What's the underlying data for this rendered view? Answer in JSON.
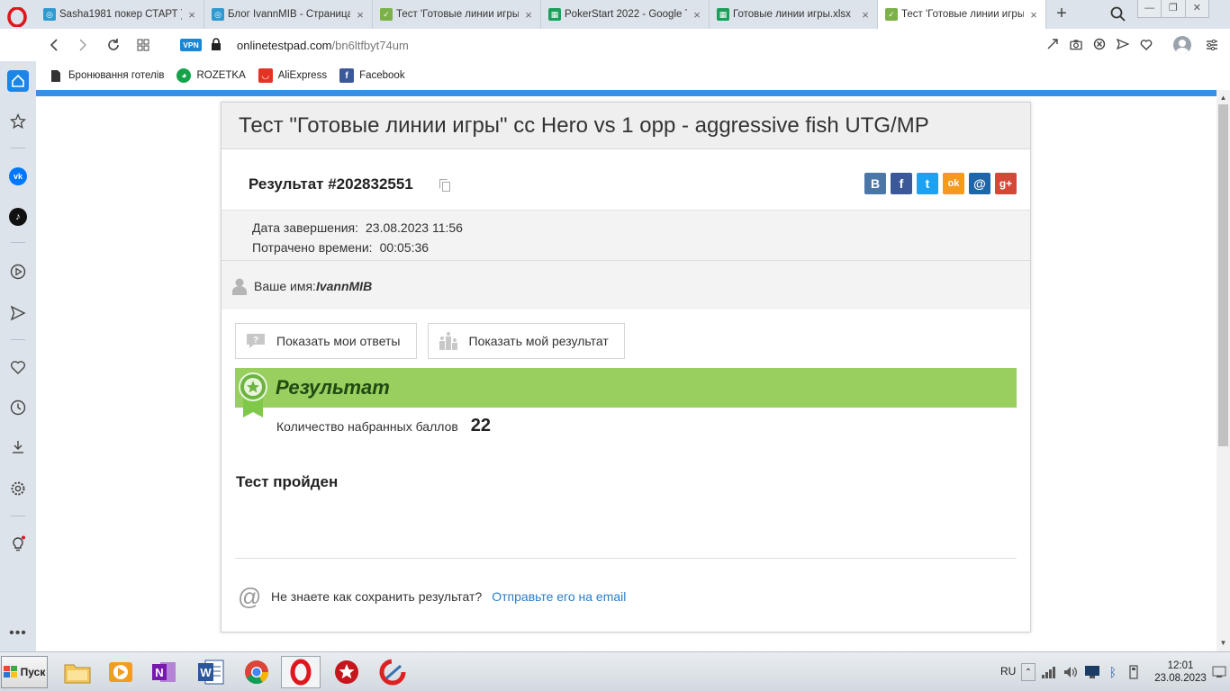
{
  "browser": {
    "tabs": [
      {
        "title": "Sasha1981 покер СТАРТ )",
        "favicon": "poker-globe-icon",
        "color": "#2e9ad0",
        "active": false
      },
      {
        "title": "Блог IvannMIB - Страница",
        "favicon": "poker-globe-icon",
        "color": "#2e9ad0",
        "active": false
      },
      {
        "title": "Тест 'Готовые линии игры",
        "favicon": "onlinetestpad-icon",
        "color": "#7bb04a",
        "active": false
      },
      {
        "title": "PokerStart 2022 - Google T",
        "favicon": "google-sheets-icon",
        "color": "#1e9e5a",
        "active": false
      },
      {
        "title": "Готовые линии игры.xlsx",
        "favicon": "google-sheets-icon",
        "color": "#1e9e5a",
        "active": false
      },
      {
        "title": "Тест 'Готовые линии игры",
        "favicon": "onlinetestpad-icon",
        "color": "#7bb04a",
        "active": true
      }
    ],
    "vpn_label": "VPN",
    "url_host": "onlinetestpad.com",
    "url_path": "/bn6ltfbyt74um",
    "bookmarks": [
      {
        "label": "Бронювання готелів",
        "icon": "document-icon"
      },
      {
        "label": "ROZETKA",
        "icon": "rozetka-icon"
      },
      {
        "label": "AliExpress",
        "icon": "aliexpress-icon"
      },
      {
        "label": "Facebook",
        "icon": "facebook-icon"
      }
    ]
  },
  "test": {
    "title": "Тест \"Готовые линии игры\" cc Hero vs 1 opp - aggressive fish UTG/MP",
    "result_title": "Результат #202832551",
    "completed_label": "Дата завершения:",
    "completed_value": "23.08.2023 11:56",
    "time_label": "Потрачено времени:",
    "time_value": "00:05:36",
    "name_label": "Ваше имя:",
    "name_value": "IvannMIB",
    "show_answers": "Показать мои ответы",
    "show_result": "Показать мой результат",
    "result_heading": "Результат",
    "score_label": "Количество набранных баллов",
    "score_value": "22",
    "passed": "Тест пройден",
    "save_question": "Не знаете как сохранить результат?",
    "save_link": "Отправьте его на email"
  },
  "share": [
    {
      "icon": "vk-icon",
      "glyph": "В",
      "color": "#4a76a8"
    },
    {
      "icon": "facebook-icon",
      "glyph": "f",
      "color": "#3b5998"
    },
    {
      "icon": "twitter-icon",
      "glyph": "t",
      "color": "#1da1f2"
    },
    {
      "icon": "odnoklassniki-icon",
      "glyph": "ok",
      "color": "#f59a1c"
    },
    {
      "icon": "mailru-icon",
      "glyph": "@",
      "color": "#1e66a9"
    },
    {
      "icon": "googleplus-icon",
      "glyph": "g+",
      "color": "#d34836"
    }
  ],
  "taskbar": {
    "start_label": "Пуск",
    "lang": "RU",
    "time": "12:01",
    "date": "23.08.2023"
  }
}
